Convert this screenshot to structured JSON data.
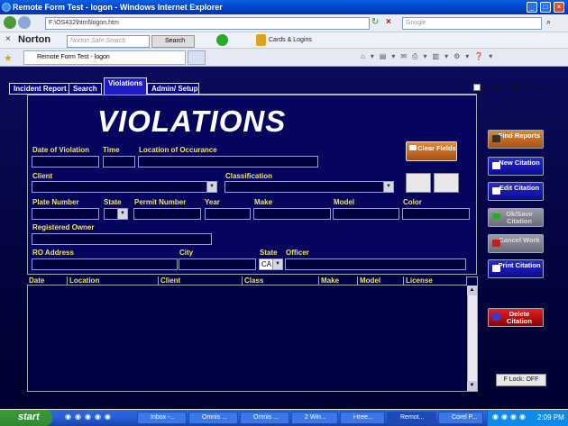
{
  "window": {
    "title": "Remote Form Test - logon - Windows Internet Explorer"
  },
  "address": {
    "url": "F:\\OS432\\html\\logon.htm",
    "search_placeholder": "Google"
  },
  "norton": {
    "brand": "Norton",
    "search_placeholder": "Norton Safe Search",
    "search_button": "Search",
    "cards_label": "Cards & Logins"
  },
  "browser_tab": {
    "title": "Remote Form Test - logon"
  },
  "app": {
    "tabs": [
      "Incident Report",
      "Search",
      "Violations",
      "Admin/ Setup"
    ],
    "approved_label": "Approved/Finalized",
    "heading": "VIOLATIONS",
    "labels": {
      "date": "Date of Violation",
      "time": "Time",
      "location": "Location of Occurance",
      "client": "Client",
      "classification": "Classification",
      "plate": "Plate Number",
      "state": "State",
      "permit": "Permit Number",
      "year": "Year",
      "make": "Make",
      "model": "Model",
      "color": "Color",
      "owner": "Registered Owner",
      "ro_address": "RO Address",
      "city": "City",
      "state2": "State",
      "officer": "Officer"
    },
    "state_value": "CA",
    "clear_fields": "Clear Fields",
    "side_buttons": {
      "find": "Find Reports",
      "new": "New Citation",
      "edit": "Edit Citation",
      "ok_save": "Ok/Save Citation",
      "cancel": "Cancel Work",
      "print": "Print Citation",
      "delete": "Delete Citation"
    },
    "grid_columns": [
      "Date",
      "Location",
      "Client",
      "Class",
      "Make",
      "Model",
      "License"
    ],
    "flock": "F Lock: OFF"
  },
  "taskbar": {
    "start": "start",
    "tasks": [
      "Inbox -...",
      "Omnis ...",
      "Omnis ...",
      "2 Win...",
      "i-tree...",
      "Remot...",
      "Corel P..."
    ],
    "clock": "2:09 PM"
  },
  "colors": {
    "app_bg": "#05055e",
    "label": "#f2e36a",
    "delete": "#c00000",
    "orange": "#c86a1e"
  }
}
